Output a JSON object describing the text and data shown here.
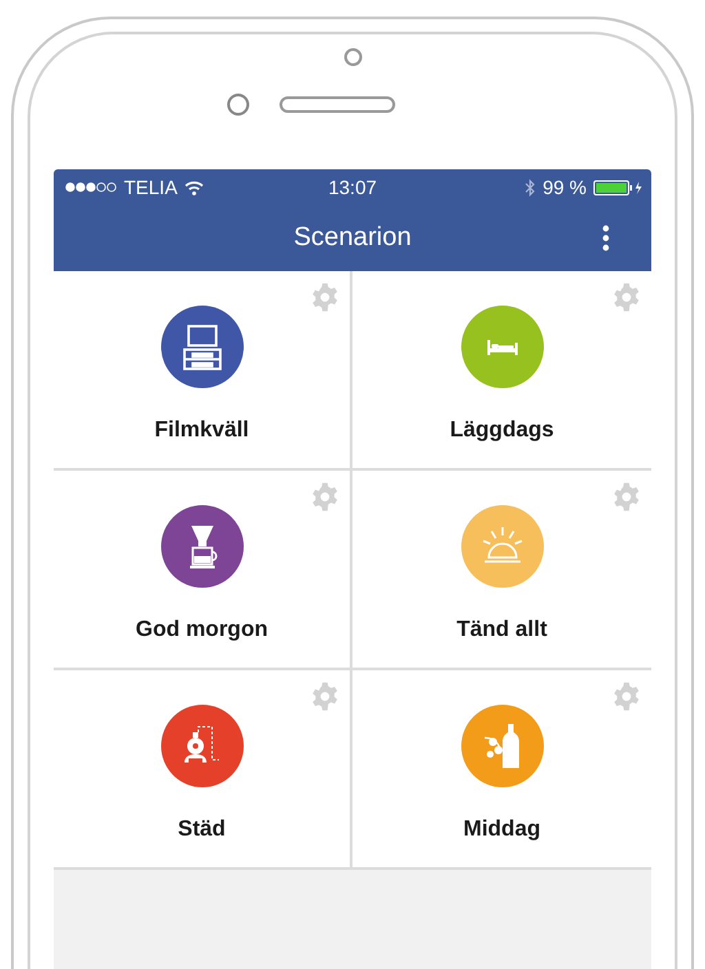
{
  "status_bar": {
    "carrier": "TELIA",
    "time": "13:07",
    "battery": "99 %"
  },
  "header": {
    "title": "Scenarion"
  },
  "scenes": [
    {
      "label": "Filmkväll",
      "color": "#3f57a6",
      "kind": "tv"
    },
    {
      "label": "Läggdags",
      "color": "#97c11f",
      "kind": "bed"
    },
    {
      "label": "God morgon",
      "color": "#7e4596",
      "kind": "coffee"
    },
    {
      "label": "Tänd allt",
      "color": "#f7be5c",
      "kind": "lamp"
    },
    {
      "label": "Städ",
      "color": "#e5402a",
      "kind": "vacuum"
    },
    {
      "label": "Middag",
      "color": "#f39c1a",
      "kind": "dinner"
    }
  ]
}
